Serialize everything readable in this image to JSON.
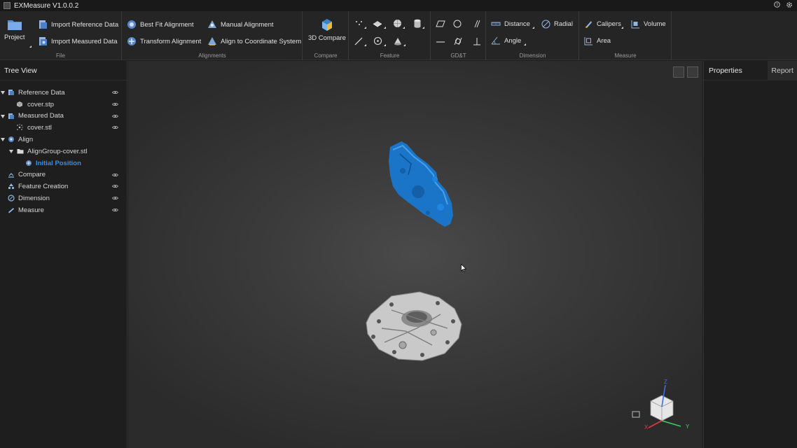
{
  "window": {
    "title": "EXMeasure V1.0.0.2"
  },
  "ribbon": {
    "file": {
      "label": "File",
      "project": "Project",
      "import_reference": "Import Reference Data",
      "import_measured": "Import Measured Data"
    },
    "alignments": {
      "label": "Alignments",
      "best_fit": "Best Fit Alignment",
      "manual": "Manual Alignment",
      "transform": "Transform Alignment",
      "coordinate": "Align to Coordinate System"
    },
    "compare": {
      "label": "Compare",
      "button": "3D Compare"
    },
    "feature": {
      "label": "Feature"
    },
    "gdt": {
      "label": "GD&T"
    },
    "dimension": {
      "label": "Dimension",
      "distance": "Distance",
      "radial": "Radial",
      "angle": "Angle"
    },
    "measure": {
      "label": "Measure",
      "calipers": "Calipers",
      "volume": "Volume",
      "area": "Area"
    }
  },
  "tree": {
    "header": "Tree View",
    "items": [
      {
        "label": "Reference Data",
        "icon": "reference-data-icon"
      },
      {
        "label": "cover.stp",
        "icon": "solid-model-icon"
      },
      {
        "label": "Measured Data",
        "icon": "measured-data-icon"
      },
      {
        "label": "cover.stl",
        "icon": "point-cloud-icon"
      },
      {
        "label": "Align",
        "icon": "align-icon"
      },
      {
        "label": "AlignGroup-cover.stl",
        "icon": "folder-icon"
      },
      {
        "label": "Initial Position",
        "icon": "alignment-state-icon"
      },
      {
        "label": "Compare",
        "icon": "compare-icon"
      },
      {
        "label": "Feature Creation",
        "icon": "feature-icon"
      },
      {
        "label": "Dimension",
        "icon": "dimension-icon"
      },
      {
        "label": "Measure",
        "icon": "measure-icon"
      }
    ]
  },
  "right_panel": {
    "tab_properties": "Properties",
    "tab_report": "Report"
  },
  "viewcube": {
    "axis_x": "X",
    "axis_y": "Y",
    "axis_z": "Z"
  },
  "colors": {
    "accent": "#3b8fe0",
    "measured_part": "#1a74c8",
    "reference_part": "#c9c9c9"
  }
}
